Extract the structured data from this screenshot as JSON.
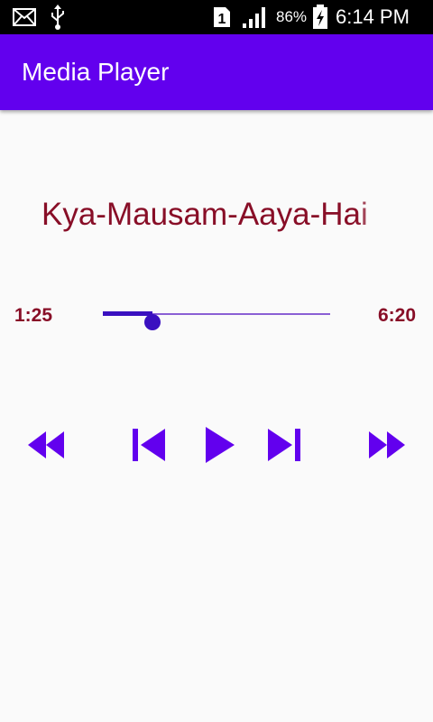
{
  "status_bar": {
    "icons": [
      "mail-icon",
      "usb-icon",
      "sim-1-icon",
      "signal-icon",
      "battery-charging-icon"
    ],
    "battery_percent": "86%",
    "time": "6:14 PM"
  },
  "app_bar": {
    "title": "Media Player",
    "color": "#6200ee"
  },
  "player": {
    "song_title": "Kya-Mausam-Aaya-Hai",
    "current_time": "1:25",
    "total_time": "6:20",
    "progress": 0.22,
    "title_color": "#880e27",
    "accent": "#6200ee",
    "controls": [
      {
        "name": "rewind",
        "icon": "rewind-icon"
      },
      {
        "name": "previous",
        "icon": "skip-previous-icon"
      },
      {
        "name": "play",
        "icon": "play-icon"
      },
      {
        "name": "next",
        "icon": "skip-next-icon"
      },
      {
        "name": "fast-forward",
        "icon": "fast-forward-icon"
      }
    ]
  }
}
